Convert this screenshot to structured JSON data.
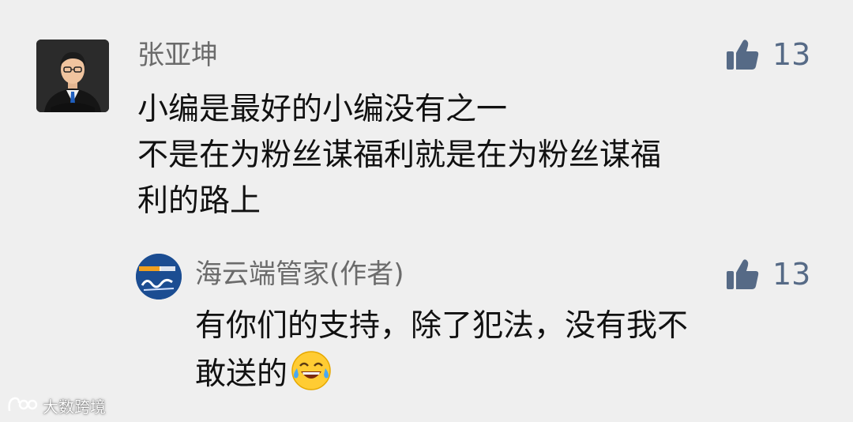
{
  "main_comment": {
    "author": "张亚坤",
    "like_count": "13",
    "lines": [
      "小编是最好的小编没有之一",
      "不是在为粉丝谋福利就是在为粉丝谋福",
      "利的路上"
    ]
  },
  "reply": {
    "author": "海云端管家(作者)",
    "like_count": "13",
    "lines": [
      "有你们的支持，除了犯法，没有我不",
      "敢送的"
    ],
    "emoji": "tears-of-joy-emoji"
  },
  "watermark": {
    "text": "大数跨境",
    "icon": "logo-icon"
  },
  "colors": {
    "background": "#efefef",
    "like": "#566a86",
    "name": "#6b6b6b",
    "text": "#111111"
  }
}
